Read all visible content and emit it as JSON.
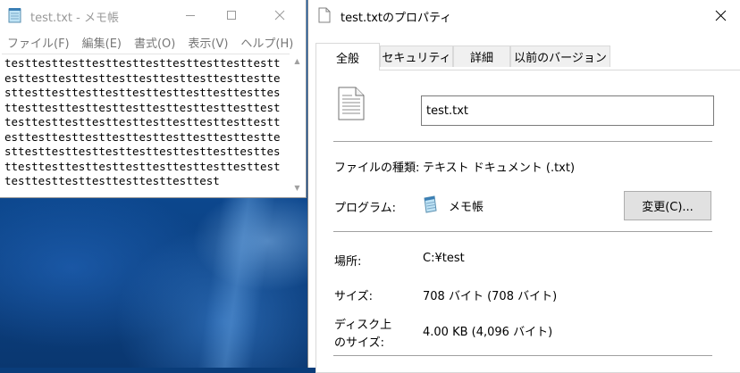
{
  "notepad": {
    "title": "test.txt - メモ帳",
    "menu": [
      "ファイル(F)",
      "編集(E)",
      "書式(O)",
      "表示(V)",
      "ヘルプ(H)"
    ],
    "content": "testtesttesttesttesttesttesttesttesttesttesttesttesttesttesttesttesttesttesttesttesttesttesttesttesttesttesttesttesttesttesttesttesttesttesttesttesttesttesttesttesttesttesttesttesttesttesttesttesttesttesttesttesttesttesttesttesttesttesttesttesttesttesttesttesttesttesttesttesttesttesttesttesttesttesttesttesttesttesttesttesttesttesttesttesttesttesttesttesttest",
    "icon": "notepad-icon"
  },
  "properties": {
    "title": "test.txtのプロパティ",
    "tabs": [
      "全般",
      "セキュリティ",
      "詳細",
      "以前のバージョン"
    ],
    "active_tab": "全般",
    "file_name": "test.txt",
    "type_label": "ファイルの種類:",
    "type_value": "テキスト ドキュメント (.txt)",
    "program_label": "プログラム:",
    "program_value": "メモ帳",
    "change_button": "変更(C)...",
    "location_label": "場所:",
    "location_value": "C:¥test",
    "size_label": "サイズ:",
    "size_value": "708 バイト (708 バイト)",
    "disk_size_label_line1": "ディスク上",
    "disk_size_label_line2": "のサイズ:",
    "disk_size_value": "4.00 KB (4,096 バイト)"
  },
  "colors": {
    "desktop": "#1664b8",
    "button_face": "#e1e1e1",
    "separator": "#a0a0a0"
  }
}
